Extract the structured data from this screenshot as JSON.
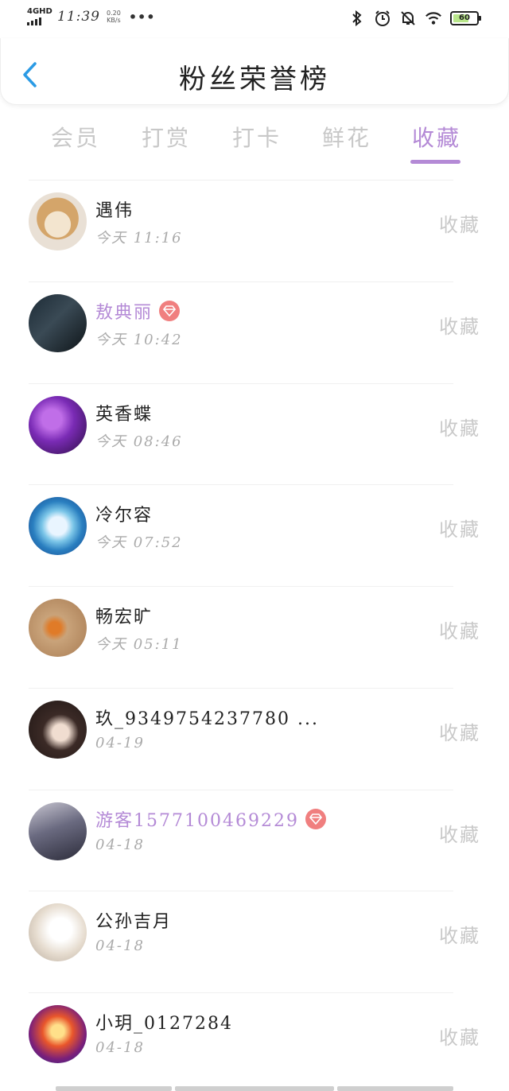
{
  "status_bar": {
    "network": "4GHD",
    "time": "11:39",
    "speed_value": "0.20",
    "speed_unit": "KB/s",
    "more": "•••",
    "battery": "60",
    "icons": [
      "bluetooth-icon",
      "alarm-icon",
      "mute-icon",
      "wifi-icon",
      "battery-icon"
    ]
  },
  "header": {
    "title": "粉丝荣誉榜",
    "back_icon": "chevron-left-icon"
  },
  "tabs": [
    {
      "label": "会员",
      "active": false
    },
    {
      "label": "打赏",
      "active": false
    },
    {
      "label": "打卡",
      "active": false
    },
    {
      "label": "鲜花",
      "active": false
    },
    {
      "label": "收藏",
      "active": true
    }
  ],
  "colors": {
    "accent": "#b48ad6",
    "back_arrow": "#2b9be5",
    "vip_badge": "#f07f7f",
    "muted_text": "#c9c9c9"
  },
  "fans": [
    {
      "name": "遇伟",
      "time": "今天 11:16",
      "action": "收藏",
      "vip": false
    },
    {
      "name": "敖典丽",
      "time": "今天 10:42",
      "action": "收藏",
      "vip": true
    },
    {
      "name": "英香蝶",
      "time": "今天 08:46",
      "action": "收藏",
      "vip": false
    },
    {
      "name": "冷尔容",
      "time": "今天 07:52",
      "action": "收藏",
      "vip": false
    },
    {
      "name": "畅宏旷",
      "time": "今天 05:11",
      "action": "收藏",
      "vip": false
    },
    {
      "name": "玖_9349754237780 ...",
      "time": "04-19",
      "action": "收藏",
      "vip": false
    },
    {
      "name": "游客15771004692​29",
      "time": "04-18",
      "action": "收藏",
      "vip": true
    },
    {
      "name": "公孙吉月",
      "time": "04-18",
      "action": "收藏",
      "vip": false
    },
    {
      "name": "小玥_0127284",
      "time": "04-18",
      "action": "收藏",
      "vip": false
    }
  ]
}
